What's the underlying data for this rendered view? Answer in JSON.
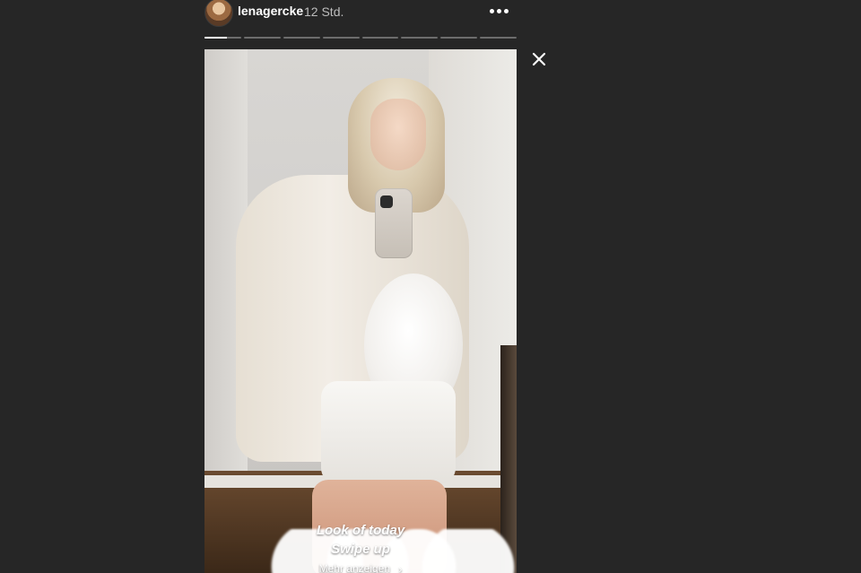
{
  "story": {
    "username": "lenagercke",
    "timestamp": "12 Std.",
    "overlay_line_1": "Look of today",
    "overlay_line_2": "Swipe up",
    "cta_label": "Mehr anzeigen",
    "cta_chevron": "›"
  },
  "progress": {
    "segments_total": 8,
    "active_segment_index": 0,
    "active_segment_fill": 0.6
  },
  "icons": {
    "more": "more-horizontal-icon",
    "close": "close-icon",
    "chevron": "chevron-right-icon",
    "avatar": "profile-avatar"
  },
  "colors": {
    "page_background": "#262626",
    "text_primary": "#ffffff",
    "text_secondary": "#bdbdbd",
    "progress_inactive": "#6c6c6c",
    "progress_active": "#ffffff"
  }
}
